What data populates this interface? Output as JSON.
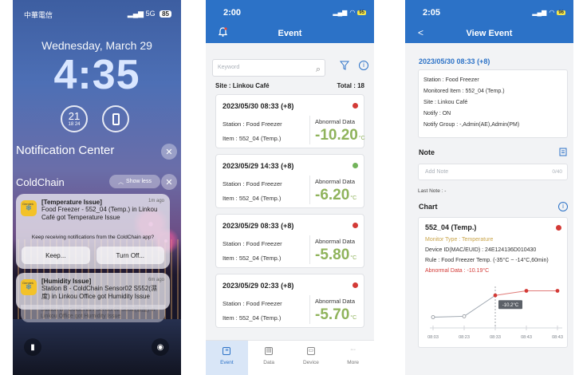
{
  "lock": {
    "carrier": "中華電信",
    "signal": "5G",
    "battery": "85",
    "date": "Wednesday, March 29",
    "time": "4:35",
    "widget_temp": "21",
    "widget_range": "18  24",
    "notification_center": "Notification Center",
    "app_name": "ColdChain",
    "show_less": "Show less",
    "notif1": {
      "title": "[Temperature Issue]",
      "ago": "1m ago",
      "body": "Food Freezer - 552_04 (Temp.) in Linkou Café got Temperature Issue",
      "prompt": "Keep receiving notifications from the ColdChain app?",
      "keep": "Keep...",
      "turn_off": "Turn Off..."
    },
    "notif2": {
      "title": "[Humidity Issue]",
      "ago": "6m ago",
      "body": "Station B - ColdChain Sensor02 S552(濕度) in Linkou Office got Humidity Issue",
      "behind": "Station B - ColdChain Sensor02 S552(濕度) in Linkou Office got Humidity Issue"
    },
    "icon_brand": "Gemtek"
  },
  "event": {
    "time": "2:00",
    "battery": "95",
    "title": "Event",
    "search_placeholder": "Keyword",
    "site": "Site : Linkou Café",
    "total": "Total : 18",
    "labels": {
      "abnormal": "Abnormal Data",
      "unit": "°C"
    },
    "cards": [
      {
        "datetime": "2023/05/30 08:33 (+8)",
        "station": "Station : Food Freezer",
        "item": "Item : 552_04 (Temp.)",
        "value": "-10.20",
        "status": "#d33a36"
      },
      {
        "datetime": "2023/05/29 14:33 (+8)",
        "station": "Station : Food Freezer",
        "item": "Item : 552_04 (Temp.)",
        "value": "-6.20",
        "status": "#72b35a"
      },
      {
        "datetime": "2023/05/29 08:33 (+8)",
        "station": "Station : Food Freezer",
        "item": "Item : 552_04 (Temp.)",
        "value": "-5.80",
        "status": "#d33a36"
      },
      {
        "datetime": "2023/05/29 02:33 (+8)",
        "station": "Station : Food Freezer",
        "item": "Item : 552_04 (Temp.)",
        "value": "-5.70",
        "status": "#d33a36"
      }
    ],
    "nav": [
      "Event",
      "Data",
      "Device",
      "More"
    ]
  },
  "view": {
    "time": "2:05",
    "battery": "96",
    "back": "<",
    "title": "View Event",
    "datetime": "2023/05/30 08:33 (+8)",
    "info": [
      "Station : Food Freezer",
      "Monitored Item : 552_04 (Temp.)",
      "Site : Linkou Café",
      "Notify : ON",
      "Notify Group : -,Admin(AE),Admin(PM)"
    ],
    "note_header": "Note",
    "note_placeholder": "Add Note",
    "note_count": "0/40",
    "last_note": "Last Note : -",
    "chart_header": "Chart",
    "chart_title": "552_04 (Temp.)",
    "monitor_type": "Monitor Type : Temperature",
    "device_id": "Device ID(MAC/EUID) : 24E124136D010430",
    "rule": "Rule : Food Freezer Temp. (-35°C ~ -14°C,60min)",
    "abnormal": "Abnormal Data : -10.19°C",
    "tooltip": "-10.2°C"
  },
  "colors": {
    "primary": "#2c72c7",
    "good": "#8fb35b",
    "alert": "#d33a36"
  },
  "chart_data": {
    "type": "line",
    "x": [
      "08:03",
      "08:23",
      "08:33",
      "08:43",
      "08:43"
    ],
    "series": [
      {
        "values": [
          -35,
          -34,
          -10.2,
          -5,
          -5
        ]
      }
    ],
    "annotations": [
      "-10.2°C"
    ]
  }
}
